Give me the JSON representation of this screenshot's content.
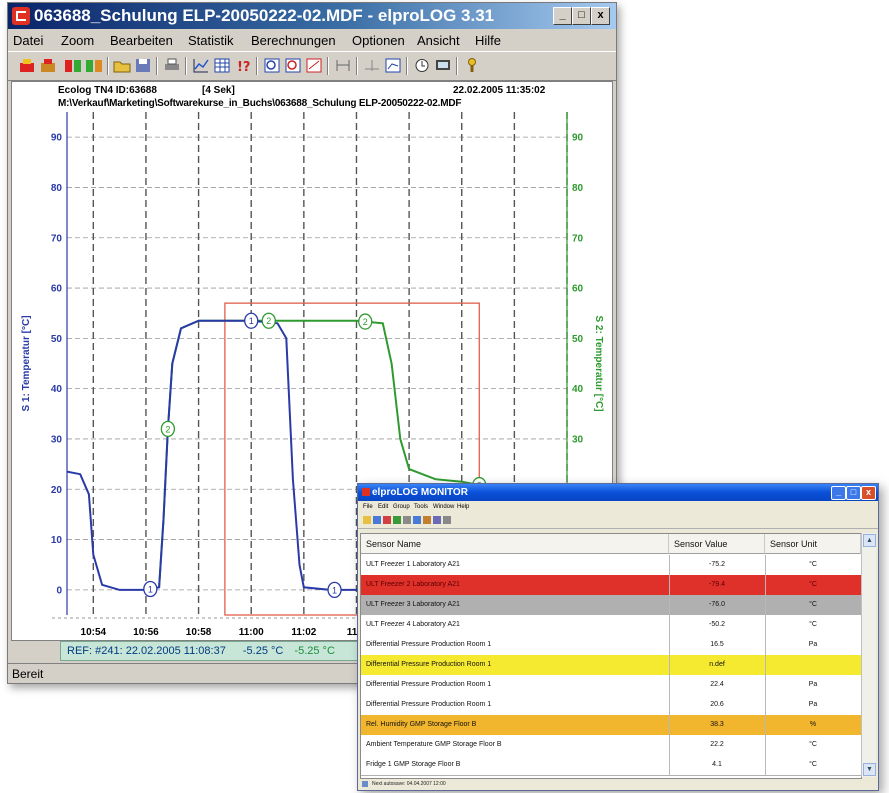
{
  "main_window": {
    "title": "063688_Schulung ELP-20050222-02.MDF - elproLOG 3.31",
    "menu": [
      "Datei",
      "Zoom",
      "Bearbeiten",
      "Statistik",
      "Berechnungen",
      "Optionen",
      "Ansicht",
      "Hilfe"
    ],
    "controls": [
      "_",
      "□",
      "x"
    ],
    "toolbar_icons": [
      "logger-read-icon",
      "logger-program-icon",
      "multi-logger-icon",
      "multi-program-icon",
      "open-folder-icon",
      "save-icon",
      "print-icon",
      "chart-view-icon",
      "table-view-icon",
      "info-icon",
      "zoom-icon",
      "zoom-area-icon",
      "zoom-reset-icon",
      "split-icon",
      "reference-icon",
      "scale-icon",
      "clock-icon",
      "display-icon",
      "help-icon"
    ],
    "chart_header": {
      "logger": "Ecolog TN4  ID:63688",
      "interval": "[4 Sek]",
      "datetime": "22.02.2005  11:35:02",
      "path": "M:\\Verkauf\\Marketing\\Softwarekurse_in_Buchs\\063688_Schulung ELP-20050222-02.MDF"
    },
    "reference_bar": {
      "text": "REF: #241: 22.02.2005  11:08:37",
      "s1": "-5.25 °C",
      "s2": "-5.25 °C"
    },
    "status": "Bereit",
    "colors": {
      "s1": "#2a3aa8",
      "s2": "#2f9a2f",
      "zoom_rect": "#e0604a",
      "refbar": "#c8e6d8"
    }
  },
  "chart_data": {
    "type": "line",
    "y_left_label": "S 1: Temperatur [°C]",
    "y_right_label": "S 2: Temperatur [°C]",
    "y_ticks": [
      0,
      10,
      20,
      30,
      40,
      50,
      60,
      70,
      80,
      90
    ],
    "ylim": [
      -5,
      95
    ],
    "x_tick_labels": [
      "10:54",
      "10:56",
      "10:58",
      "11:00",
      "11:02",
      "11:0"
    ],
    "x_date": "22.02.2005",
    "xlim": [
      "10:53",
      "11:12"
    ],
    "series": [
      {
        "name": "S 1",
        "marker": "1",
        "points": [
          [
            "10:53",
            23.5
          ],
          [
            "10:53:30",
            23
          ],
          [
            "10:53:50",
            19
          ],
          [
            "10:54",
            7
          ],
          [
            "10:54:20",
            1
          ],
          [
            "10:55",
            0
          ],
          [
            "10:56",
            0
          ],
          [
            "10:56:30",
            0.5
          ],
          [
            "10:56:40",
            14
          ],
          [
            "10:56:50",
            32
          ],
          [
            "10:57",
            45
          ],
          [
            "10:57:20",
            52
          ],
          [
            "10:58",
            53.5
          ],
          [
            "11:00",
            53.5
          ],
          [
            "11:01",
            53
          ],
          [
            "11:01:20",
            50
          ],
          [
            "11:01:35",
            22
          ],
          [
            "11:01:50",
            5
          ],
          [
            "11:02",
            0.5
          ],
          [
            "11:03",
            0
          ],
          [
            "11:04",
            0
          ],
          [
            "11:05",
            0
          ],
          [
            "11:06",
            0
          ],
          [
            "11:07",
            0
          ],
          [
            "11:08",
            18
          ],
          [
            "11:09",
            19.5
          ],
          [
            "11:10",
            20.5
          ],
          [
            "11:11",
            21
          ]
        ],
        "markers_at": [
          "10:56:10",
          "11:00:00",
          "11:03:10"
        ]
      },
      {
        "name": "S 2",
        "marker": "2",
        "points": [
          [
            "10:56:30",
            0.5
          ],
          [
            "10:56:40",
            14
          ],
          [
            "10:56:50",
            32
          ],
          [
            "10:57",
            45
          ],
          [
            "10:57:20",
            52
          ],
          [
            "10:58",
            53.5
          ],
          [
            "11:00",
            53.5
          ],
          [
            "11:01",
            53.5
          ],
          [
            "11:02",
            53.5
          ],
          [
            "11:03",
            53.5
          ],
          [
            "11:04",
            53.5
          ],
          [
            "11:05",
            53
          ],
          [
            "11:05:20",
            45
          ],
          [
            "11:05:40",
            30
          ],
          [
            "11:06",
            24
          ],
          [
            "11:07",
            22
          ],
          [
            "11:08",
            21.5
          ],
          [
            "11:09",
            20.5
          ],
          [
            "11:10",
            20.5
          ],
          [
            "11:11",
            21
          ]
        ],
        "markers_at": [
          "10:56:50",
          "11:00:40",
          "11:04:20",
          "11:08:40"
        ]
      }
    ],
    "zoom_rect": {
      "x0": "10:59",
      "x1": "11:08:40",
      "y0": -5,
      "y1": 57
    },
    "grid": true
  },
  "monitor_window": {
    "title": "elproLOG MONITOR",
    "menu": [
      "File",
      "Edit",
      "Group",
      "Tools",
      "Window",
      "Help"
    ],
    "columns": [
      "Sensor Name",
      "Sensor Value",
      "Sensor Unit"
    ],
    "rows": [
      {
        "name": "ULT Freezer 1 Laboratory A21",
        "value": "-75.2",
        "unit": "°C",
        "color": "#ffffff"
      },
      {
        "name": "ULT Freezer 2 Laboratory A21",
        "value": "-79.4",
        "unit": "°C",
        "color": "#e0302a"
      },
      {
        "name": "ULT Freezer 3 Laboratory A21",
        "value": "-76.0",
        "unit": "°C",
        "color": "#b0b0b0"
      },
      {
        "name": "ULT Freezer 4 Laboratory A21",
        "value": "-50.2",
        "unit": "°C",
        "color": "#ffffff"
      },
      {
        "name": "Differential Pressure Production Room 1",
        "value": "16.5",
        "unit": "Pa",
        "color": "#ffffff"
      },
      {
        "name": "Differential Pressure Production Room 1",
        "value": "n.def",
        "unit": "",
        "color": "#f5ea30"
      },
      {
        "name": "Differential Pressure Production Room 1",
        "value": "22.4",
        "unit": "Pa",
        "color": "#ffffff"
      },
      {
        "name": "Differential Pressure Production Room 1",
        "value": "20.6",
        "unit": "Pa",
        "color": "#ffffff"
      },
      {
        "name": "Rel. Humidity GMP Storage Floor B",
        "value": "38.3",
        "unit": "%",
        "color": "#f2b52e"
      },
      {
        "name": "Ambient Temperature GMP Storage Floor B",
        "value": "22.2",
        "unit": "°C",
        "color": "#ffffff"
      },
      {
        "name": "Fridge 1 GMP Storage Floor B",
        "value": "4.1",
        "unit": "°C",
        "color": "#ffffff"
      }
    ],
    "status": "Next autosave: 04.04.2007 12:00"
  }
}
